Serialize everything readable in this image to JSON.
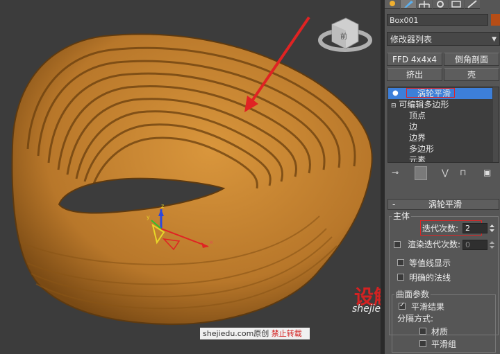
{
  "panel": {
    "object_name": "Box001",
    "object_color": "#b64d16",
    "modifier_list": "修改器列表",
    "buttons": {
      "ffd": "FFD 4x4x4",
      "chamfer": "倒角剖面",
      "extrude": "挤出",
      "shell": "壳"
    },
    "stack": {
      "turbosmooth": "涡轮平滑",
      "editable_poly": "可编辑多边形",
      "children": [
        "顶点",
        "边",
        "边界",
        "多边形",
        "元素"
      ]
    },
    "rollout": {
      "collapse": "-",
      "title": "涡轮平滑",
      "main_group": "主体",
      "iterations_label": "迭代次数:",
      "iterations_value": "2",
      "render_iters_label": "渲染迭代次数:",
      "render_iters_value": "0",
      "isoline_label": "等值线显示",
      "explicit_normals_label": "明确的法线",
      "surface_group": "曲面参数",
      "smooth_result_label": "平滑结果",
      "separate_label": "分隔方式:",
      "materials_label": "材质",
      "smoothing_groups_label": "平滑组"
    }
  },
  "viewport": {
    "gizmo_labels": {
      "x": "x",
      "y": "y",
      "z": "z"
    },
    "viewcube_label": "前",
    "model_color": "#c8852e",
    "arrow_color": "#e02323"
  },
  "watermark": {
    "logo_a": "设",
    "logo_b": "解读",
    "url": "shejiedu.com",
    "source": "shejiedu.com原创",
    "no_repost": "禁止转载"
  }
}
